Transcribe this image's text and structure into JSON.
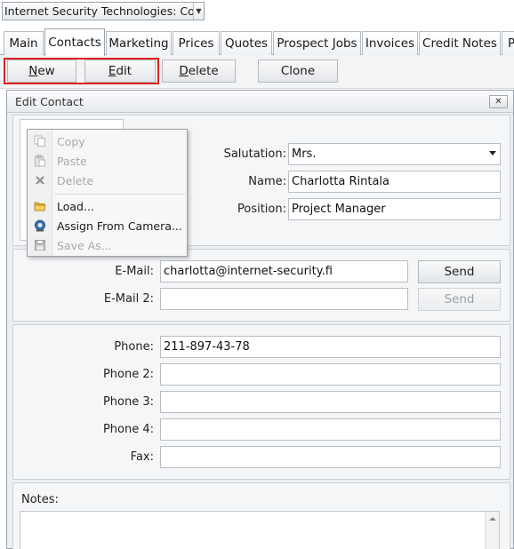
{
  "window_title": "Internet Security Technologies: Contacts",
  "tabs": [
    {
      "label": "Main"
    },
    {
      "label": "Contacts"
    },
    {
      "label": "Marketing"
    },
    {
      "label": "Prices"
    },
    {
      "label": "Quotes"
    },
    {
      "label": "Prospect Jobs"
    },
    {
      "label": "Invoices"
    },
    {
      "label": "Credit Notes"
    },
    {
      "label": "P"
    }
  ],
  "active_tab": "Contacts",
  "toolbar": {
    "new_first": "N",
    "new_rest": "ew",
    "edit_first": "E",
    "edit_rest": "dit",
    "delete_first": "D",
    "delete_rest": "elete",
    "clone_label": "Clone",
    "highlight_color": "#e02020"
  },
  "dialog": {
    "title": "Edit Contact",
    "close_glyph": "✕"
  },
  "context_menu": {
    "items": [
      {
        "label": "Copy",
        "icon": "copy-icon",
        "enabled": false
      },
      {
        "label": "Paste",
        "icon": "paste-icon",
        "enabled": false
      },
      {
        "label": "Delete",
        "icon": "delete-icon",
        "enabled": false
      },
      {
        "label": "Load...",
        "icon": "folder-icon",
        "enabled": true
      },
      {
        "label": "Assign From Camera...",
        "icon": "camera-icon",
        "enabled": true
      },
      {
        "label": "Save As...",
        "icon": "save-icon",
        "enabled": false
      }
    ]
  },
  "fields": {
    "salutation": {
      "label": "Salutation:",
      "value": "Mrs."
    },
    "name": {
      "label": "Name:",
      "value": "Charlotta Rintala"
    },
    "position": {
      "label": "Position:",
      "value": "Project Manager"
    },
    "email": {
      "label": "E-Mail:",
      "value": "charlotta@internet-security.fi",
      "send_label": "Send"
    },
    "email2": {
      "label": "E-Mail 2:",
      "value": "",
      "send_label": "Send"
    },
    "phone": {
      "label": "Phone:",
      "value": "211-897-43-78"
    },
    "phone2": {
      "label": "Phone 2:",
      "value": ""
    },
    "phone3": {
      "label": "Phone 3:",
      "value": ""
    },
    "phone4": {
      "label": "Phone 4:",
      "value": ""
    },
    "fax": {
      "label": "Fax:",
      "value": ""
    },
    "notes": {
      "label": "Notes:",
      "value": ""
    }
  }
}
